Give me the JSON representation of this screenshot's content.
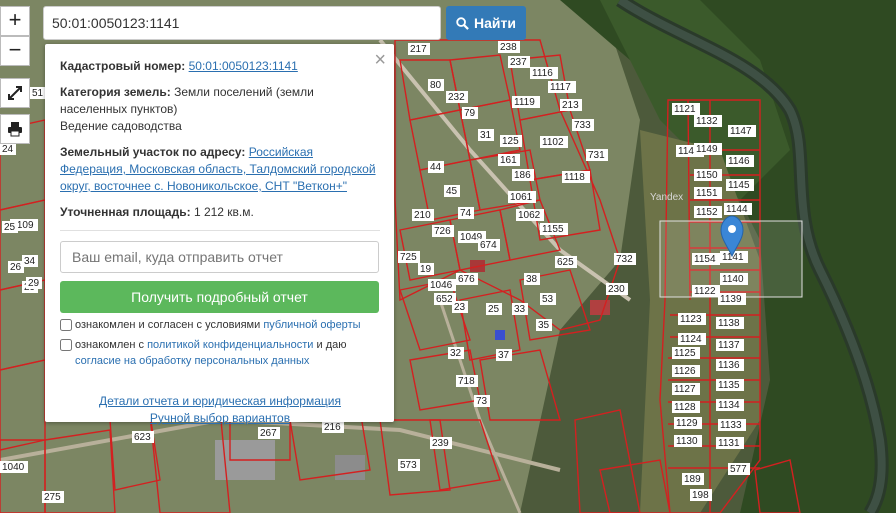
{
  "search": {
    "value": "50:01:0050123:1141",
    "button_label": "Найти"
  },
  "zoom": {
    "in_label": "+",
    "out_label": "−"
  },
  "popup": {
    "cadastral_label": "Кадастровый номер:",
    "cadastral_value": "50:01:0050123:1141",
    "category_label": "Категория земель:",
    "category_value": "Земли поселений (земли населенных пунктов)",
    "usage_value": "Ведение садоводства",
    "address_label": "Земельный участок по адресу:",
    "address_value": "Российская Федерация, Московская область, Талдомский городской округ, восточнее с. Новоникольское, СНТ \"Веткон+\"",
    "area_label": "Уточненная площадь:",
    "area_value": "1 212 кв.м.",
    "email_placeholder": "Ваш email, куда отправить отчет",
    "report_button": "Получить подробный отчет",
    "consent1_text": "ознакомлен и согласен с условиями",
    "consent1_link": "публичной оферты",
    "consent2_text": "ознакомлен с",
    "consent2_link": "политикой конфиденциальности",
    "consent2_mid": "и даю",
    "consent2_link2": "согласие на обработку персональных данных",
    "details_link": "Детали отчета и юридическая информация",
    "manual_link": "Ручной выбор вариантов"
  },
  "map": {
    "watermark": "Yandex",
    "plot_labels": [
      "217",
      "238",
      "237",
      "80",
      "232",
      "79",
      "1116",
      "1117",
      "1119",
      "213",
      "31",
      "125",
      "733",
      "1102",
      "161",
      "731",
      "186",
      "1118",
      "44",
      "45",
      "1061",
      "1062",
      "210",
      "726",
      "74",
      "1155",
      "1049",
      "674",
      "625",
      "725",
      "19",
      "1046",
      "676",
      "38",
      "732",
      "652",
      "23",
      "230",
      "25",
      "33",
      "53",
      "1121",
      "1132",
      "1147",
      "1143",
      "1149",
      "1146",
      "1150",
      "1145",
      "1151",
      "1152",
      "1144",
      "1141",
      "1154",
      "1140",
      "1122",
      "1139",
      "1123",
      "1138",
      "1124",
      "1137",
      "1125",
      "1136",
      "1126",
      "1135",
      "1127",
      "1134",
      "1128",
      "1133",
      "1129",
      "1130",
      "1131",
      "577",
      "189",
      "198",
      "1109",
      "34",
      "51",
      "24",
      "25",
      "26",
      "29",
      "37",
      "718",
      "73",
      "216",
      "267",
      "573",
      "239",
      "623",
      "1040",
      "275",
      "32",
      "35",
      "29"
    ],
    "marker_color": "#3a86d6",
    "plot_line_color": "#d42020"
  }
}
